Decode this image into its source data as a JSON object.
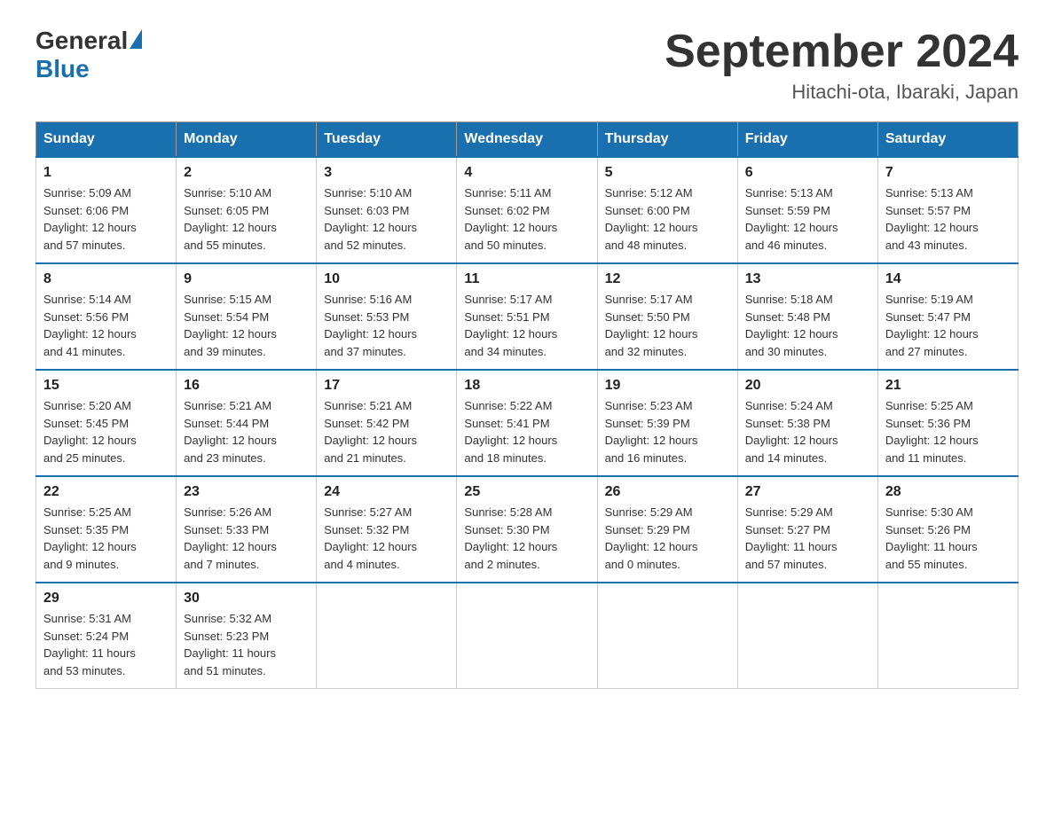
{
  "header": {
    "logo_general": "General",
    "logo_blue": "Blue",
    "month_year": "September 2024",
    "location": "Hitachi-ota, Ibaraki, Japan"
  },
  "days_of_week": [
    "Sunday",
    "Monday",
    "Tuesday",
    "Wednesday",
    "Thursday",
    "Friday",
    "Saturday"
  ],
  "weeks": [
    [
      {
        "day": "1",
        "sunrise": "5:09 AM",
        "sunset": "6:06 PM",
        "daylight": "12 hours and 57 minutes."
      },
      {
        "day": "2",
        "sunrise": "5:10 AM",
        "sunset": "6:05 PM",
        "daylight": "12 hours and 55 minutes."
      },
      {
        "day": "3",
        "sunrise": "5:10 AM",
        "sunset": "6:03 PM",
        "daylight": "12 hours and 52 minutes."
      },
      {
        "day": "4",
        "sunrise": "5:11 AM",
        "sunset": "6:02 PM",
        "daylight": "12 hours and 50 minutes."
      },
      {
        "day": "5",
        "sunrise": "5:12 AM",
        "sunset": "6:00 PM",
        "daylight": "12 hours and 48 minutes."
      },
      {
        "day": "6",
        "sunrise": "5:13 AM",
        "sunset": "5:59 PM",
        "daylight": "12 hours and 46 minutes."
      },
      {
        "day": "7",
        "sunrise": "5:13 AM",
        "sunset": "5:57 PM",
        "daylight": "12 hours and 43 minutes."
      }
    ],
    [
      {
        "day": "8",
        "sunrise": "5:14 AM",
        "sunset": "5:56 PM",
        "daylight": "12 hours and 41 minutes."
      },
      {
        "day": "9",
        "sunrise": "5:15 AM",
        "sunset": "5:54 PM",
        "daylight": "12 hours and 39 minutes."
      },
      {
        "day": "10",
        "sunrise": "5:16 AM",
        "sunset": "5:53 PM",
        "daylight": "12 hours and 37 minutes."
      },
      {
        "day": "11",
        "sunrise": "5:17 AM",
        "sunset": "5:51 PM",
        "daylight": "12 hours and 34 minutes."
      },
      {
        "day": "12",
        "sunrise": "5:17 AM",
        "sunset": "5:50 PM",
        "daylight": "12 hours and 32 minutes."
      },
      {
        "day": "13",
        "sunrise": "5:18 AM",
        "sunset": "5:48 PM",
        "daylight": "12 hours and 30 minutes."
      },
      {
        "day": "14",
        "sunrise": "5:19 AM",
        "sunset": "5:47 PM",
        "daylight": "12 hours and 27 minutes."
      }
    ],
    [
      {
        "day": "15",
        "sunrise": "5:20 AM",
        "sunset": "5:45 PM",
        "daylight": "12 hours and 25 minutes."
      },
      {
        "day": "16",
        "sunrise": "5:21 AM",
        "sunset": "5:44 PM",
        "daylight": "12 hours and 23 minutes."
      },
      {
        "day": "17",
        "sunrise": "5:21 AM",
        "sunset": "5:42 PM",
        "daylight": "12 hours and 21 minutes."
      },
      {
        "day": "18",
        "sunrise": "5:22 AM",
        "sunset": "5:41 PM",
        "daylight": "12 hours and 18 minutes."
      },
      {
        "day": "19",
        "sunrise": "5:23 AM",
        "sunset": "5:39 PM",
        "daylight": "12 hours and 16 minutes."
      },
      {
        "day": "20",
        "sunrise": "5:24 AM",
        "sunset": "5:38 PM",
        "daylight": "12 hours and 14 minutes."
      },
      {
        "day": "21",
        "sunrise": "5:25 AM",
        "sunset": "5:36 PM",
        "daylight": "12 hours and 11 minutes."
      }
    ],
    [
      {
        "day": "22",
        "sunrise": "5:25 AM",
        "sunset": "5:35 PM",
        "daylight": "12 hours and 9 minutes."
      },
      {
        "day": "23",
        "sunrise": "5:26 AM",
        "sunset": "5:33 PM",
        "daylight": "12 hours and 7 minutes."
      },
      {
        "day": "24",
        "sunrise": "5:27 AM",
        "sunset": "5:32 PM",
        "daylight": "12 hours and 4 minutes."
      },
      {
        "day": "25",
        "sunrise": "5:28 AM",
        "sunset": "5:30 PM",
        "daylight": "12 hours and 2 minutes."
      },
      {
        "day": "26",
        "sunrise": "5:29 AM",
        "sunset": "5:29 PM",
        "daylight": "12 hours and 0 minutes."
      },
      {
        "day": "27",
        "sunrise": "5:29 AM",
        "sunset": "5:27 PM",
        "daylight": "11 hours and 57 minutes."
      },
      {
        "day": "28",
        "sunrise": "5:30 AM",
        "sunset": "5:26 PM",
        "daylight": "11 hours and 55 minutes."
      }
    ],
    [
      {
        "day": "29",
        "sunrise": "5:31 AM",
        "sunset": "5:24 PM",
        "daylight": "11 hours and 53 minutes."
      },
      {
        "day": "30",
        "sunrise": "5:32 AM",
        "sunset": "5:23 PM",
        "daylight": "11 hours and 51 minutes."
      },
      null,
      null,
      null,
      null,
      null
    ]
  ]
}
